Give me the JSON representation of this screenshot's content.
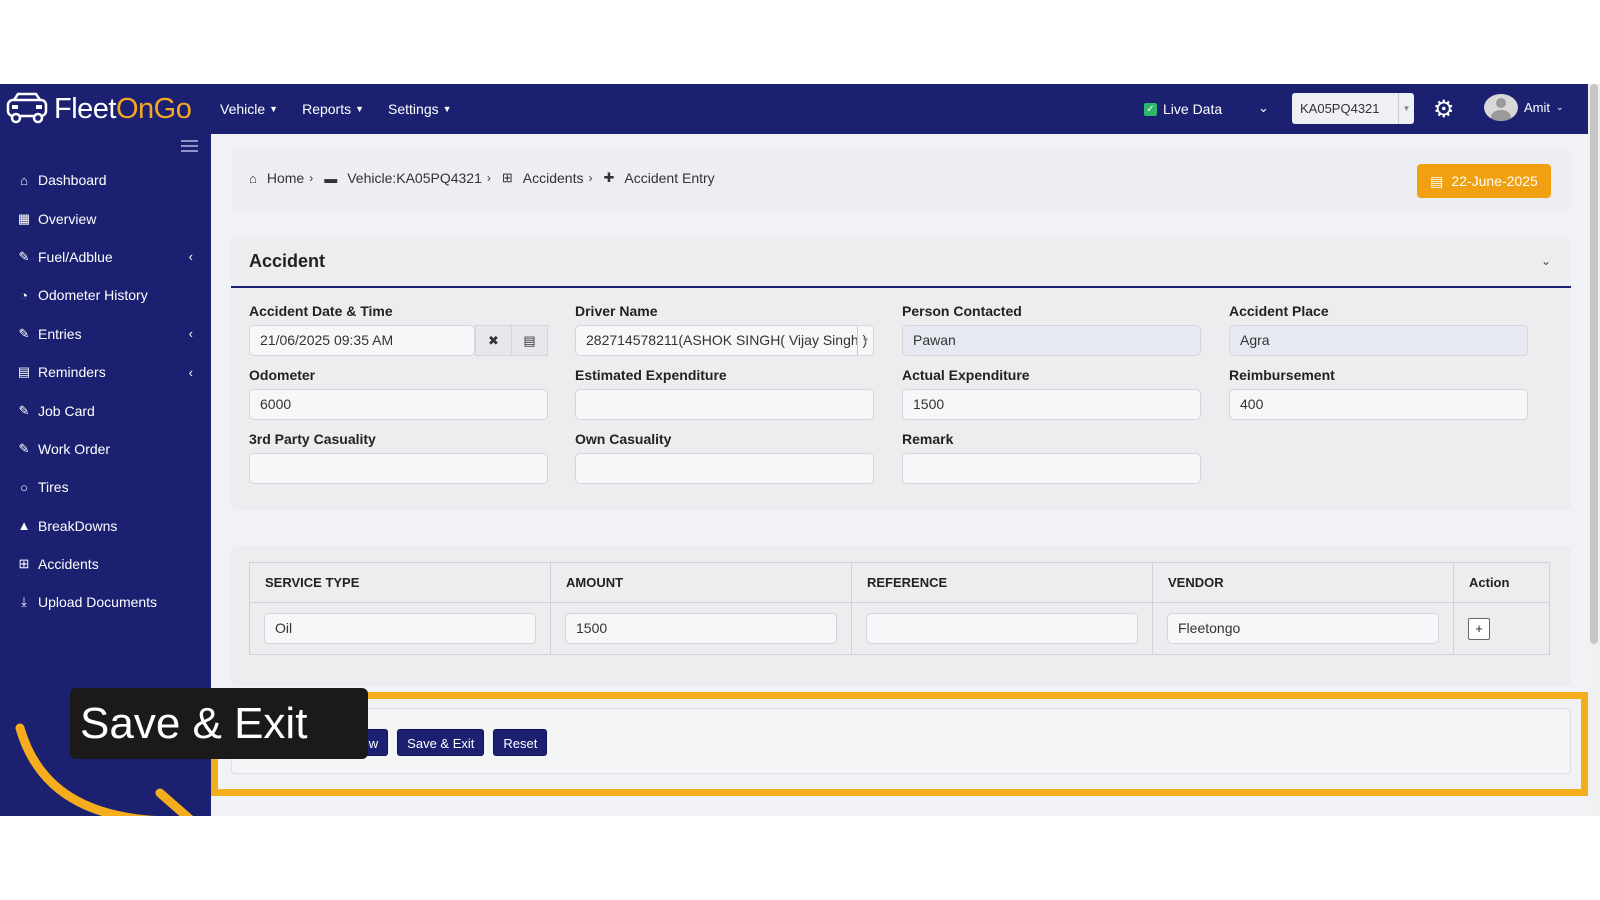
{
  "brand": {
    "part1": "Fleet",
    "part2": "OnGo"
  },
  "topnav": {
    "menu": [
      {
        "label": "Vehicle"
      },
      {
        "label": "Reports"
      },
      {
        "label": "Settings"
      }
    ],
    "live_data_label": "Live Data",
    "vehicle_selected": "KA05PQ4321",
    "user_name": "Amit"
  },
  "sidebar": {
    "items": [
      {
        "label": "Dashboard",
        "icon": "home-icon"
      },
      {
        "label": "Overview",
        "icon": "grid-icon"
      },
      {
        "label": "Fuel/Adblue",
        "icon": "edit-icon"
      },
      {
        "label": "Odometer History",
        "icon": "gauge-icon"
      },
      {
        "label": "Entries",
        "icon": "edit-icon"
      },
      {
        "label": "Reminders",
        "icon": "calendar-icon"
      },
      {
        "label": "Job Card",
        "icon": "edit-icon"
      },
      {
        "label": "Work Order",
        "icon": "edit-icon"
      },
      {
        "label": "Tires",
        "icon": "circle-icon"
      },
      {
        "label": "BreakDowns",
        "icon": "warning-icon"
      },
      {
        "label": "Accidents",
        "icon": "plus-square-icon"
      },
      {
        "label": "Upload Documents",
        "icon": "upload-icon"
      }
    ]
  },
  "breadcrumb": {
    "home": "Home",
    "vehicle": "Vehicle:KA05PQ4321",
    "accidents": "Accidents",
    "entry": "Accident Entry"
  },
  "date_badge": "22-June-2025",
  "form": {
    "title": "Accident",
    "accident_datetime": {
      "label": "Accident Date & Time",
      "value": "21/06/2025 09:35 AM"
    },
    "driver_name": {
      "label": "Driver Name",
      "value": "282714578211(ASHOK SINGH( Vijay Singh )"
    },
    "person_contacted": {
      "label": "Person Contacted",
      "value": "Pawan"
    },
    "accident_place": {
      "label": "Accident Place",
      "value": "Agra"
    },
    "odometer": {
      "label": "Odometer",
      "value": "6000"
    },
    "estimated_expenditure": {
      "label": "Estimated Expenditure",
      "value": ""
    },
    "actual_expenditure": {
      "label": "Actual Expenditure",
      "value": "1500"
    },
    "reimbursement": {
      "label": "Reimbursement",
      "value": "400"
    },
    "third_party_casualty": {
      "label": "3rd Party Casuality",
      "value": ""
    },
    "own_casualty": {
      "label": "Own Casuality",
      "value": ""
    },
    "remark": {
      "label": "Remark",
      "value": ""
    }
  },
  "service_table": {
    "headers": [
      "SERVICE TYPE",
      "AMOUNT",
      "REFERENCE",
      "VENDOR",
      "Action"
    ],
    "row": {
      "service_type": "Oil",
      "amount": "1500",
      "reference": "",
      "vendor": "Fleetongo",
      "action": "+"
    }
  },
  "actions": {
    "save_create_new": "Save & Create New",
    "save_exit": "Save & Exit",
    "reset": "Reset"
  },
  "tooltip": {
    "text": "Save & Exit"
  },
  "colors": {
    "nav": "#1b2170",
    "accent": "#f0a010",
    "highlight": "#f5ad1d"
  }
}
